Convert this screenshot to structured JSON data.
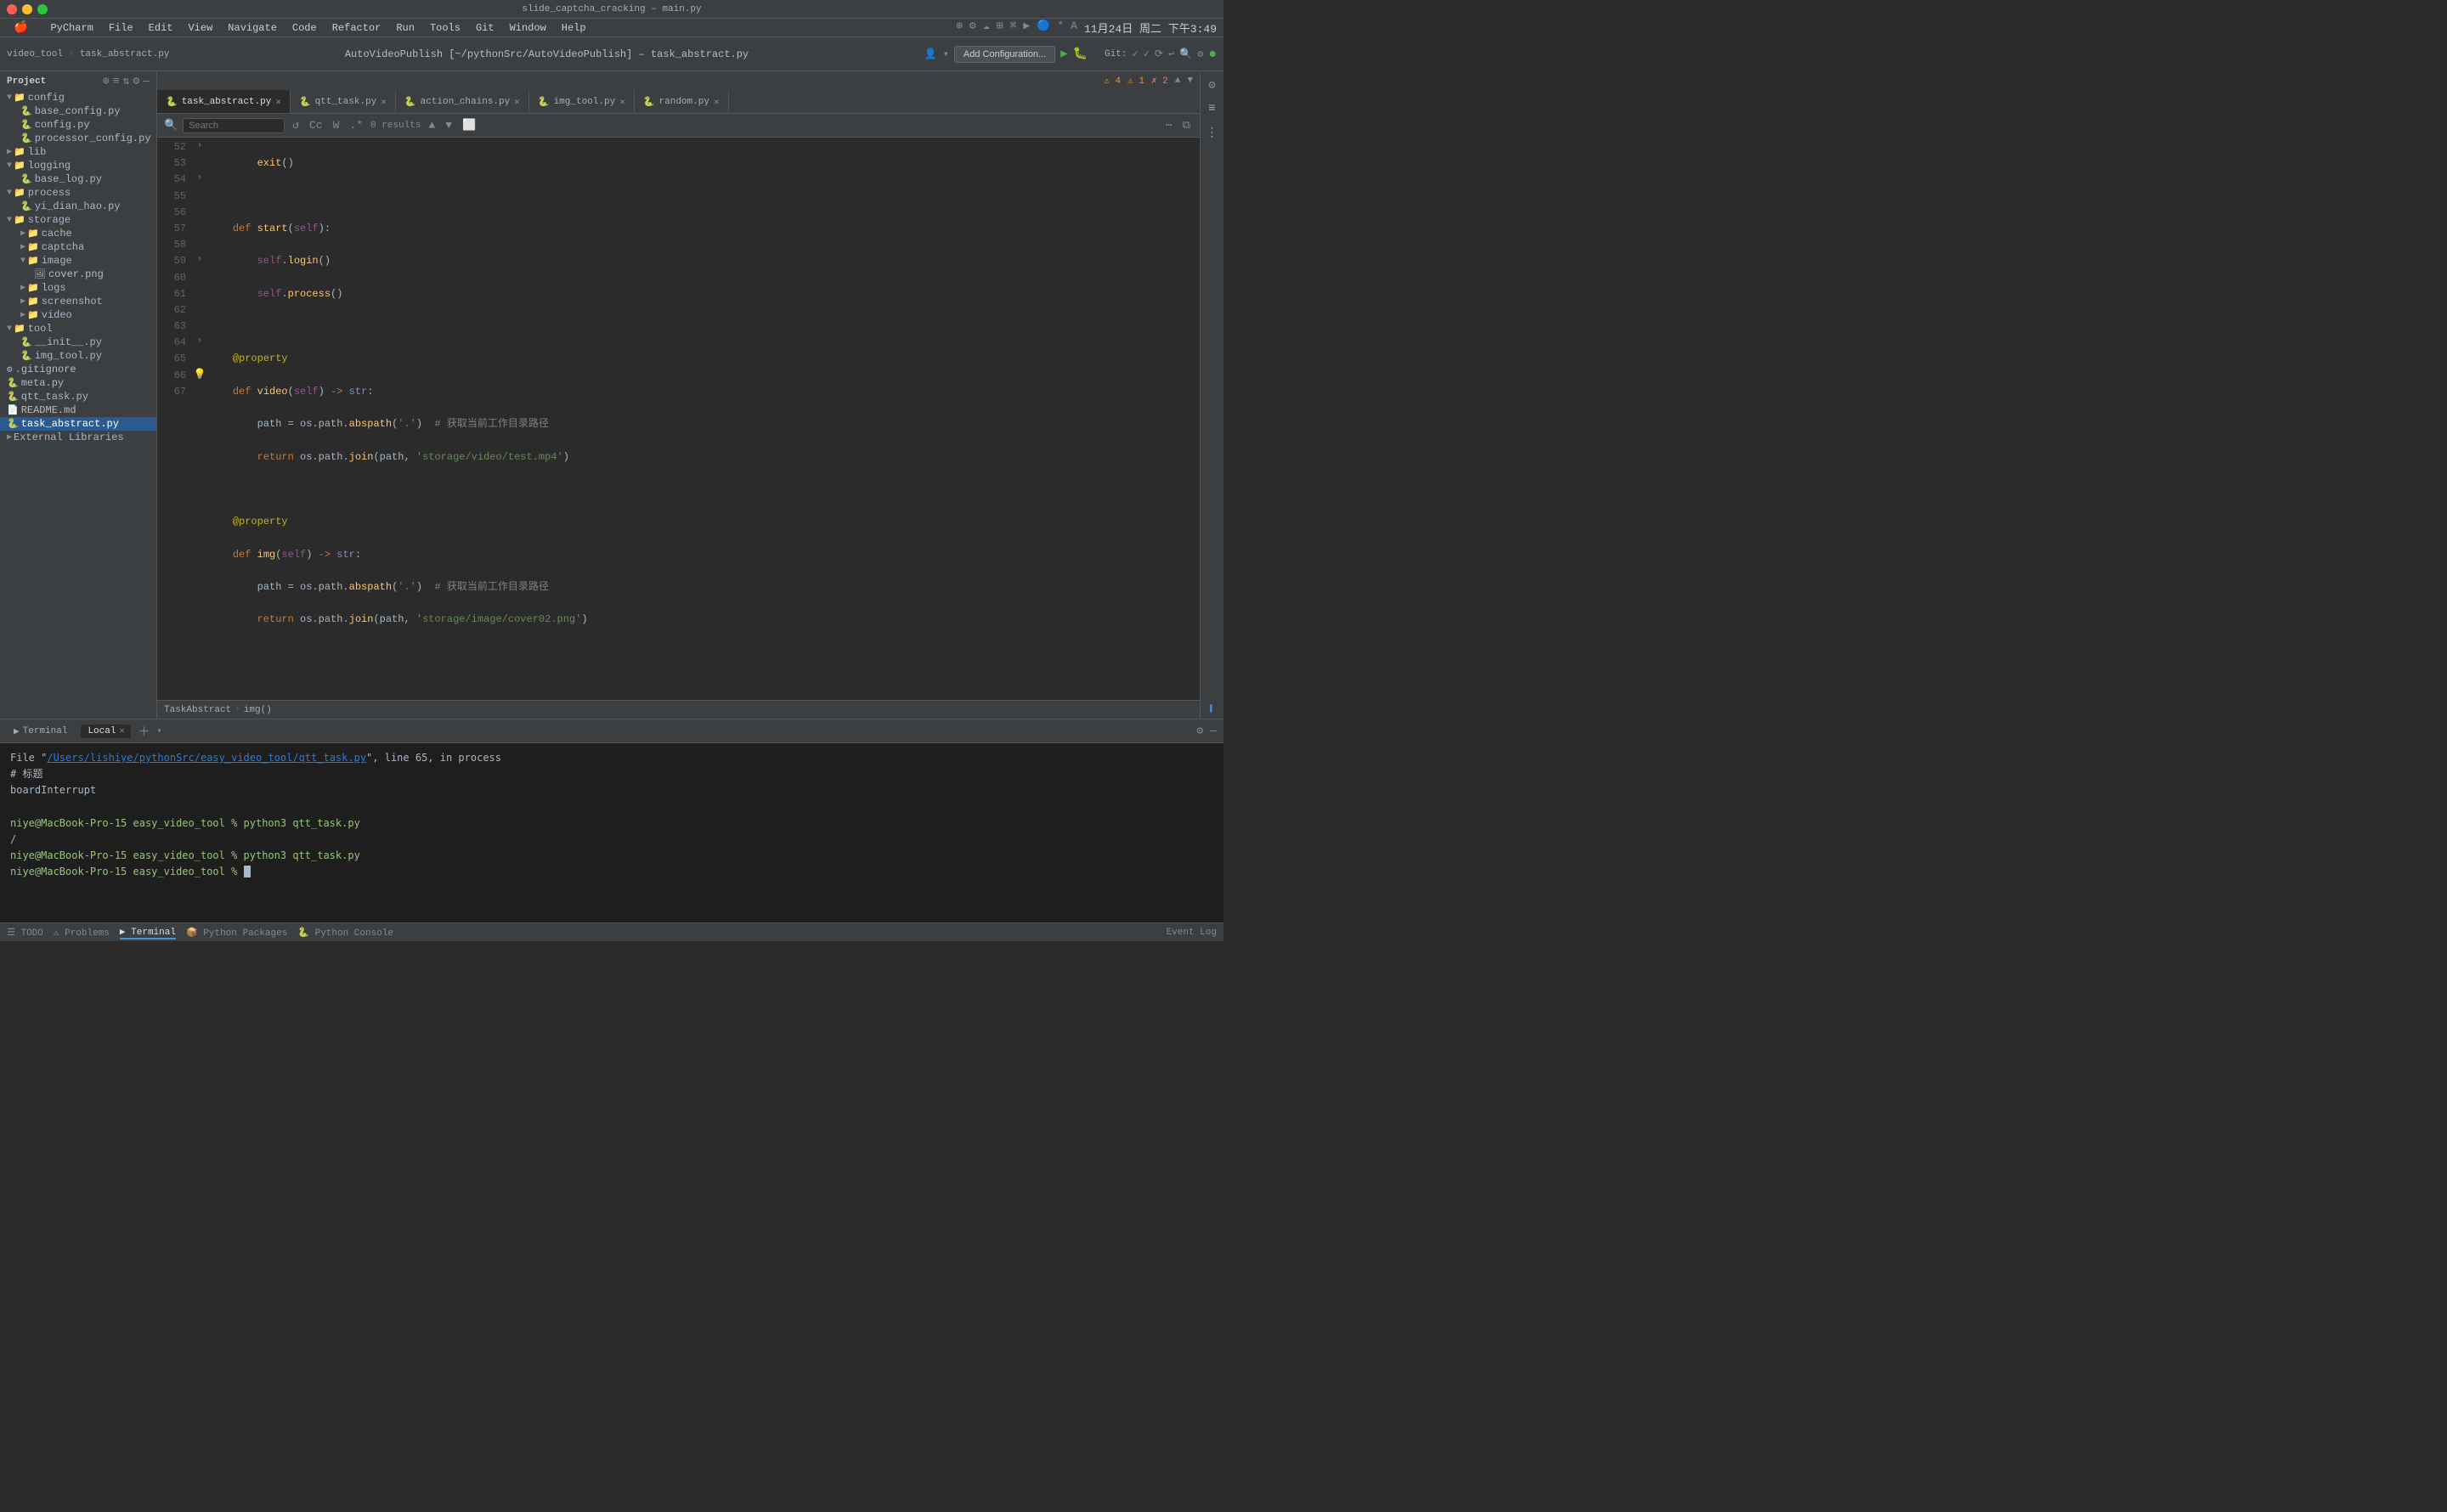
{
  "titleBar": {
    "title": "slide_captcha_cracking – main.py"
  },
  "menuBar": {
    "apple": "🍎",
    "items": [
      "PyCharm",
      "File",
      "Edit",
      "View",
      "Navigate",
      "Code",
      "Refactor",
      "Run",
      "Tools",
      "Git",
      "Window",
      "Help"
    ]
  },
  "toolbar": {
    "breadcrumb": "video_tool › task_abstract.py",
    "title": "AutoVideoPublish [~/pythonSrc/AutoVideoPublish] – task_abstract.py",
    "addConfig": "Add Configuration...",
    "gitLabel": "Git:"
  },
  "tabs": [
    {
      "label": "task_abstract.py",
      "active": true,
      "icon": "🐍"
    },
    {
      "label": "qtt_task.py",
      "active": false,
      "icon": "🐍"
    },
    {
      "label": "action_chains.py",
      "active": false,
      "icon": "🐍"
    },
    {
      "label": "img_tool.py",
      "active": false,
      "icon": "🐍"
    },
    {
      "label": "random.py",
      "active": false,
      "icon": "🐍"
    }
  ],
  "searchBar": {
    "placeholder": "Search",
    "results": "0 results"
  },
  "sidebar": {
    "header": "Project",
    "items": [
      {
        "level": 0,
        "type": "folder",
        "open": true,
        "label": "config"
      },
      {
        "level": 1,
        "type": "file",
        "label": "base_config.py"
      },
      {
        "level": 1,
        "type": "file",
        "label": "config.py"
      },
      {
        "level": 1,
        "type": "file",
        "label": "processor_config.py"
      },
      {
        "level": 0,
        "type": "folder",
        "open": false,
        "label": "lib"
      },
      {
        "level": 0,
        "type": "folder",
        "open": true,
        "label": "logging"
      },
      {
        "level": 1,
        "type": "file",
        "label": "base_log.py"
      },
      {
        "level": 0,
        "type": "folder",
        "open": true,
        "label": "process"
      },
      {
        "level": 1,
        "type": "file",
        "label": "yi_dian_hao.py"
      },
      {
        "level": 0,
        "type": "folder",
        "open": true,
        "label": "storage"
      },
      {
        "level": 1,
        "type": "folder",
        "open": false,
        "label": "cache"
      },
      {
        "level": 1,
        "type": "folder",
        "open": false,
        "label": "captcha"
      },
      {
        "level": 1,
        "type": "folder",
        "open": true,
        "label": "image"
      },
      {
        "level": 2,
        "type": "file",
        "label": "cover.png"
      },
      {
        "level": 1,
        "type": "folder",
        "open": false,
        "label": "logs"
      },
      {
        "level": 1,
        "type": "folder",
        "open": false,
        "label": "screenshot"
      },
      {
        "level": 1,
        "type": "folder",
        "open": false,
        "label": "video"
      },
      {
        "level": 0,
        "type": "folder",
        "open": true,
        "label": "tool"
      },
      {
        "level": 1,
        "type": "file",
        "label": "__init__.py"
      },
      {
        "level": 1,
        "type": "file",
        "label": "img_tool.py"
      },
      {
        "level": 0,
        "type": "file",
        "label": ".gitignore"
      },
      {
        "level": 0,
        "type": "file",
        "label": "meta.py"
      },
      {
        "level": 0,
        "type": "file",
        "label": "qtt_task.py"
      },
      {
        "level": 0,
        "type": "file",
        "label": "README.md"
      },
      {
        "level": 0,
        "type": "file",
        "label": "task_abstract.py"
      },
      {
        "level": 0,
        "type": "folder",
        "open": false,
        "label": "External Libraries"
      }
    ]
  },
  "codeLines": [
    {
      "num": 52,
      "content": "        exit()"
    },
    {
      "num": 53,
      "content": ""
    },
    {
      "num": 54,
      "content": "    def start(self):"
    },
    {
      "num": 55,
      "content": "        self.login()"
    },
    {
      "num": 56,
      "content": "        self.process()"
    },
    {
      "num": 57,
      "content": ""
    },
    {
      "num": 58,
      "content": "    @property"
    },
    {
      "num": 59,
      "content": "    def video(self) -> str:"
    },
    {
      "num": 60,
      "content": "        path = os.path.abspath('.')  # 获取当前工作目录路径"
    },
    {
      "num": 61,
      "content": "        return os.path.join(path, 'storage/video/test.mp4')"
    },
    {
      "num": 62,
      "content": ""
    },
    {
      "num": 63,
      "content": "    @property"
    },
    {
      "num": 64,
      "content": "    def img(self) -> str:"
    },
    {
      "num": 65,
      "content": "        path = os.path.abspath('.')  # 获取当前工作目录路径"
    },
    {
      "num": 66,
      "content": "        return os.path.join(path, 'storage/image/cover02.png')"
    },
    {
      "num": 67,
      "content": ""
    }
  ],
  "breadcrumb": {
    "items": [
      "TaskAbstract",
      "img()"
    ]
  },
  "warnings": {
    "warnCount": "4",
    "warnSmall": "1",
    "errorCount": "2"
  },
  "terminal": {
    "tabs": [
      {
        "label": "Terminal",
        "active": true
      },
      {
        "label": "Local",
        "active": false
      }
    ],
    "lines": [
      {
        "type": "normal",
        "text": "File \"/Users/lishiye/pythonSrc/easy_video_tool/qtt_task.py\", line 65, in process"
      },
      {
        "type": "normal",
        "text": "# 标题"
      },
      {
        "type": "normal",
        "text": "boardInterrupt"
      },
      {
        "type": "normal",
        "text": ""
      },
      {
        "type": "prompt",
        "text": "niye@MacBook-Pro-15 easy_video_tool % python3 qtt_task.py"
      },
      {
        "type": "normal",
        "text": "/"
      },
      {
        "type": "prompt",
        "text": "niye@MacBook-Pro-15 easy_video_tool % python3 qtt_task.py"
      },
      {
        "type": "prompt-current",
        "text": "niye@MacBook-Pro-15 easy_video_tool %"
      }
    ]
  },
  "bottomBar": {
    "tabs": [
      "☰ TODO",
      "⚠ Problems",
      "▶ Terminal",
      "📦 Python Packages",
      "🐍 Python Console"
    ],
    "activeTab": "▶ Terminal",
    "rightLabel": "Event Log"
  }
}
